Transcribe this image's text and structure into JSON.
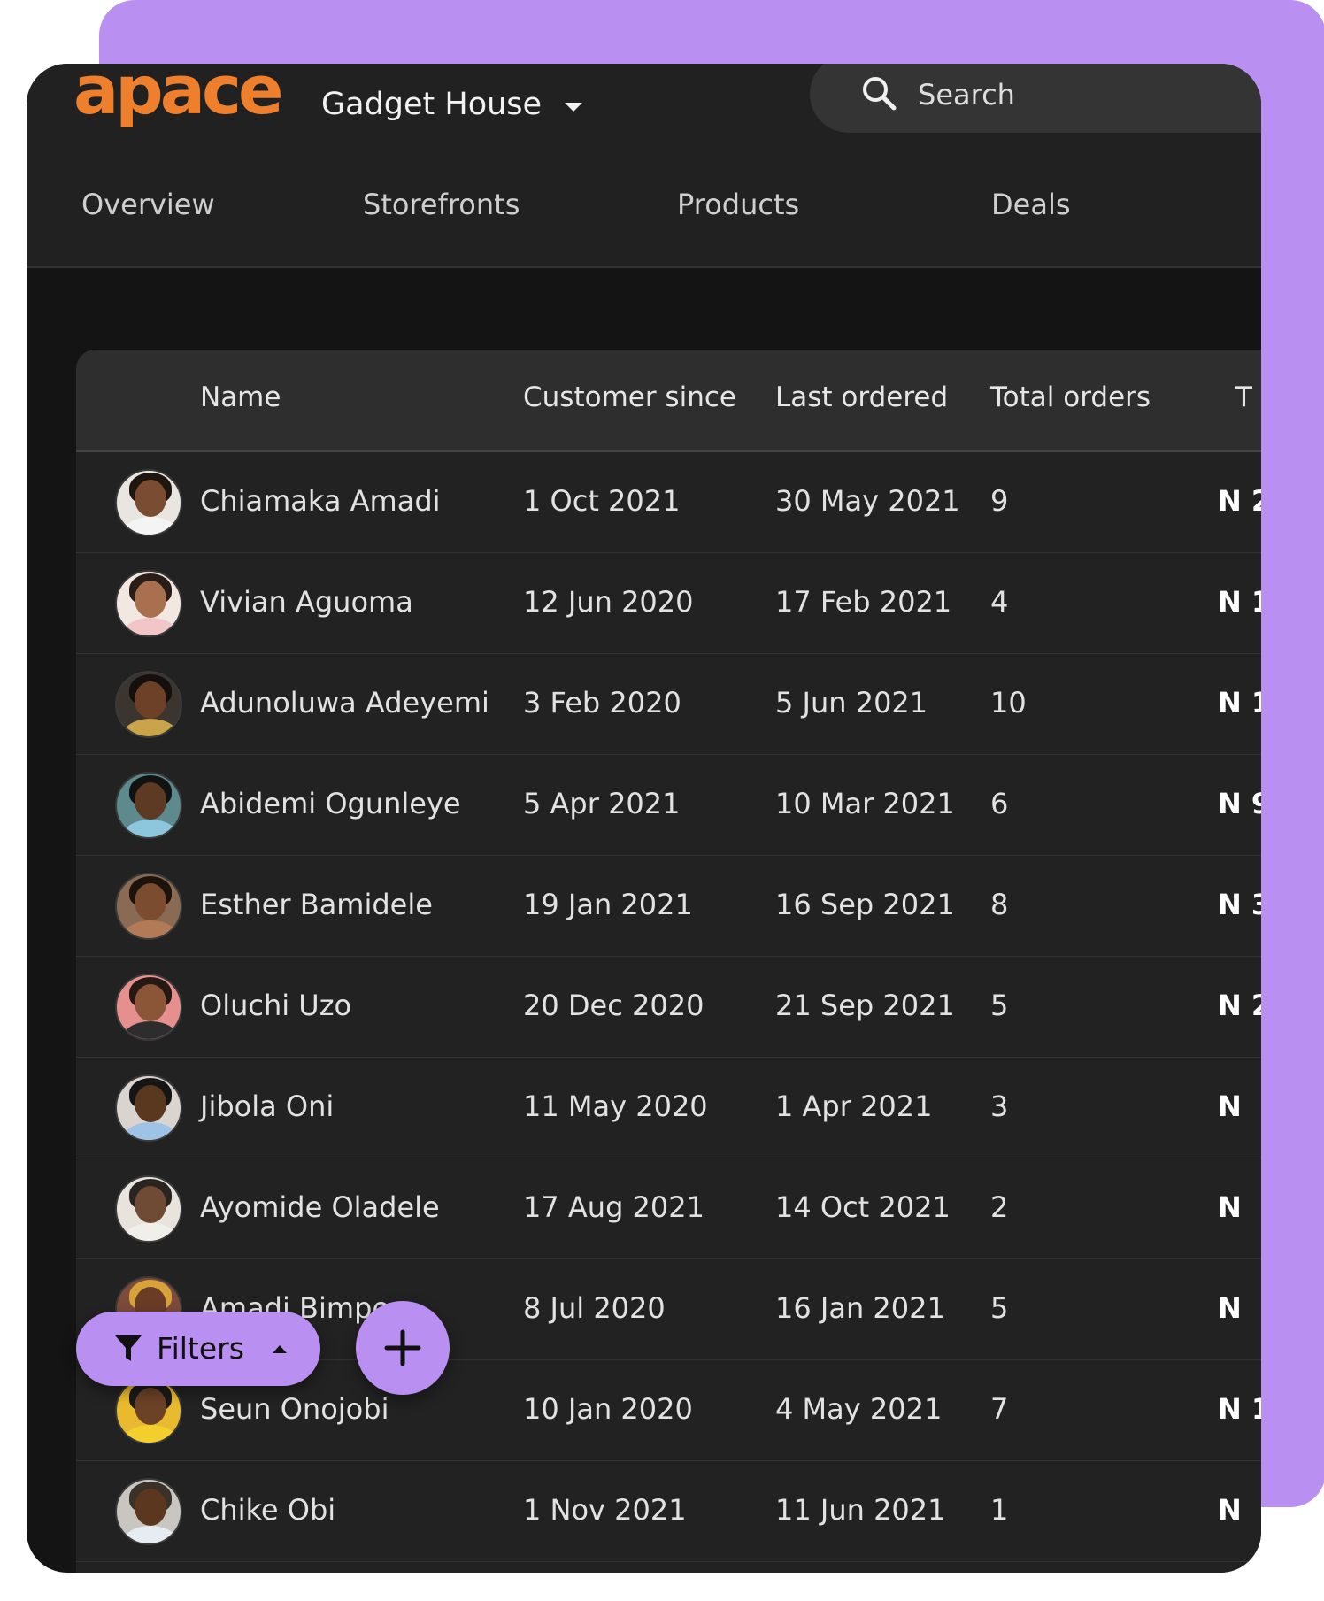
{
  "app": {
    "logo_text": "apace",
    "store_name": "Gadget House",
    "search_placeholder": "Search"
  },
  "nav": {
    "tabs": [
      {
        "label": "Overview"
      },
      {
        "label": "Storefronts"
      },
      {
        "label": "Products"
      },
      {
        "label": "Deals"
      }
    ]
  },
  "table": {
    "headers": {
      "name": "Name",
      "customer_since": "Customer since",
      "last_ordered": "Last ordered",
      "total_orders": "Total orders",
      "total_spend": "T"
    },
    "rows": [
      {
        "name": "Chiamaka Amadi",
        "since": "1 Oct 2021",
        "last": "30 May 2021",
        "orders": "9",
        "spend": "N 2"
      },
      {
        "name": "Vivian Aguoma",
        "since": "12 Jun 2020",
        "last": "17 Feb 2021",
        "orders": "4",
        "spend": "N 1"
      },
      {
        "name": "Adunoluwa Adeyemi",
        "since": "3 Feb 2020",
        "last": "5 Jun 2021",
        "orders": "10",
        "spend": "N 1,"
      },
      {
        "name": "Abidemi Ogunleye",
        "since": "5 Apr 2021",
        "last": "10 Mar 2021",
        "orders": "6",
        "spend": "N 9"
      },
      {
        "name": "Esther Bamidele",
        "since": "19 Jan 2021",
        "last": "16 Sep 2021",
        "orders": "8",
        "spend": "N 3"
      },
      {
        "name": "Oluchi Uzo",
        "since": "20 Dec 2020",
        "last": "21 Sep 2021",
        "orders": "5",
        "spend": "N 2"
      },
      {
        "name": "Jibola Oni",
        "since": "11 May 2020",
        "last": "1 Apr 2021",
        "orders": "3",
        "spend": "N"
      },
      {
        "name": "Ayomide Oladele",
        "since": "17 Aug 2021",
        "last": "14 Oct 2021",
        "orders": "2",
        "spend": "N"
      },
      {
        "name": "Amadi Bimpe",
        "since": "8 Jul 2020",
        "last": "16 Jan 2021",
        "orders": "5",
        "spend": "N"
      },
      {
        "name": "Seun Onojobi",
        "since": "10 Jan 2020",
        "last": "4 May 2021",
        "orders": "7",
        "spend": "N 1"
      },
      {
        "name": "Chike Obi",
        "since": "1 Nov 2021",
        "last": "11 Jun 2021",
        "orders": "1",
        "spend": "N"
      }
    ]
  },
  "actions": {
    "filters_label": "Filters"
  },
  "icons": {
    "search": "search-icon",
    "store_dropdown": "chevron-down-icon",
    "filter": "filter-funnel-icon",
    "filter_toggle": "caret-up-icon",
    "add": "plus-icon"
  },
  "colors": {
    "accent": "#b990f1",
    "logo": "#ee7f2c",
    "surface": "#222222",
    "header": "#2e2e2e",
    "topbar": "#212121",
    "background": "#141414"
  }
}
